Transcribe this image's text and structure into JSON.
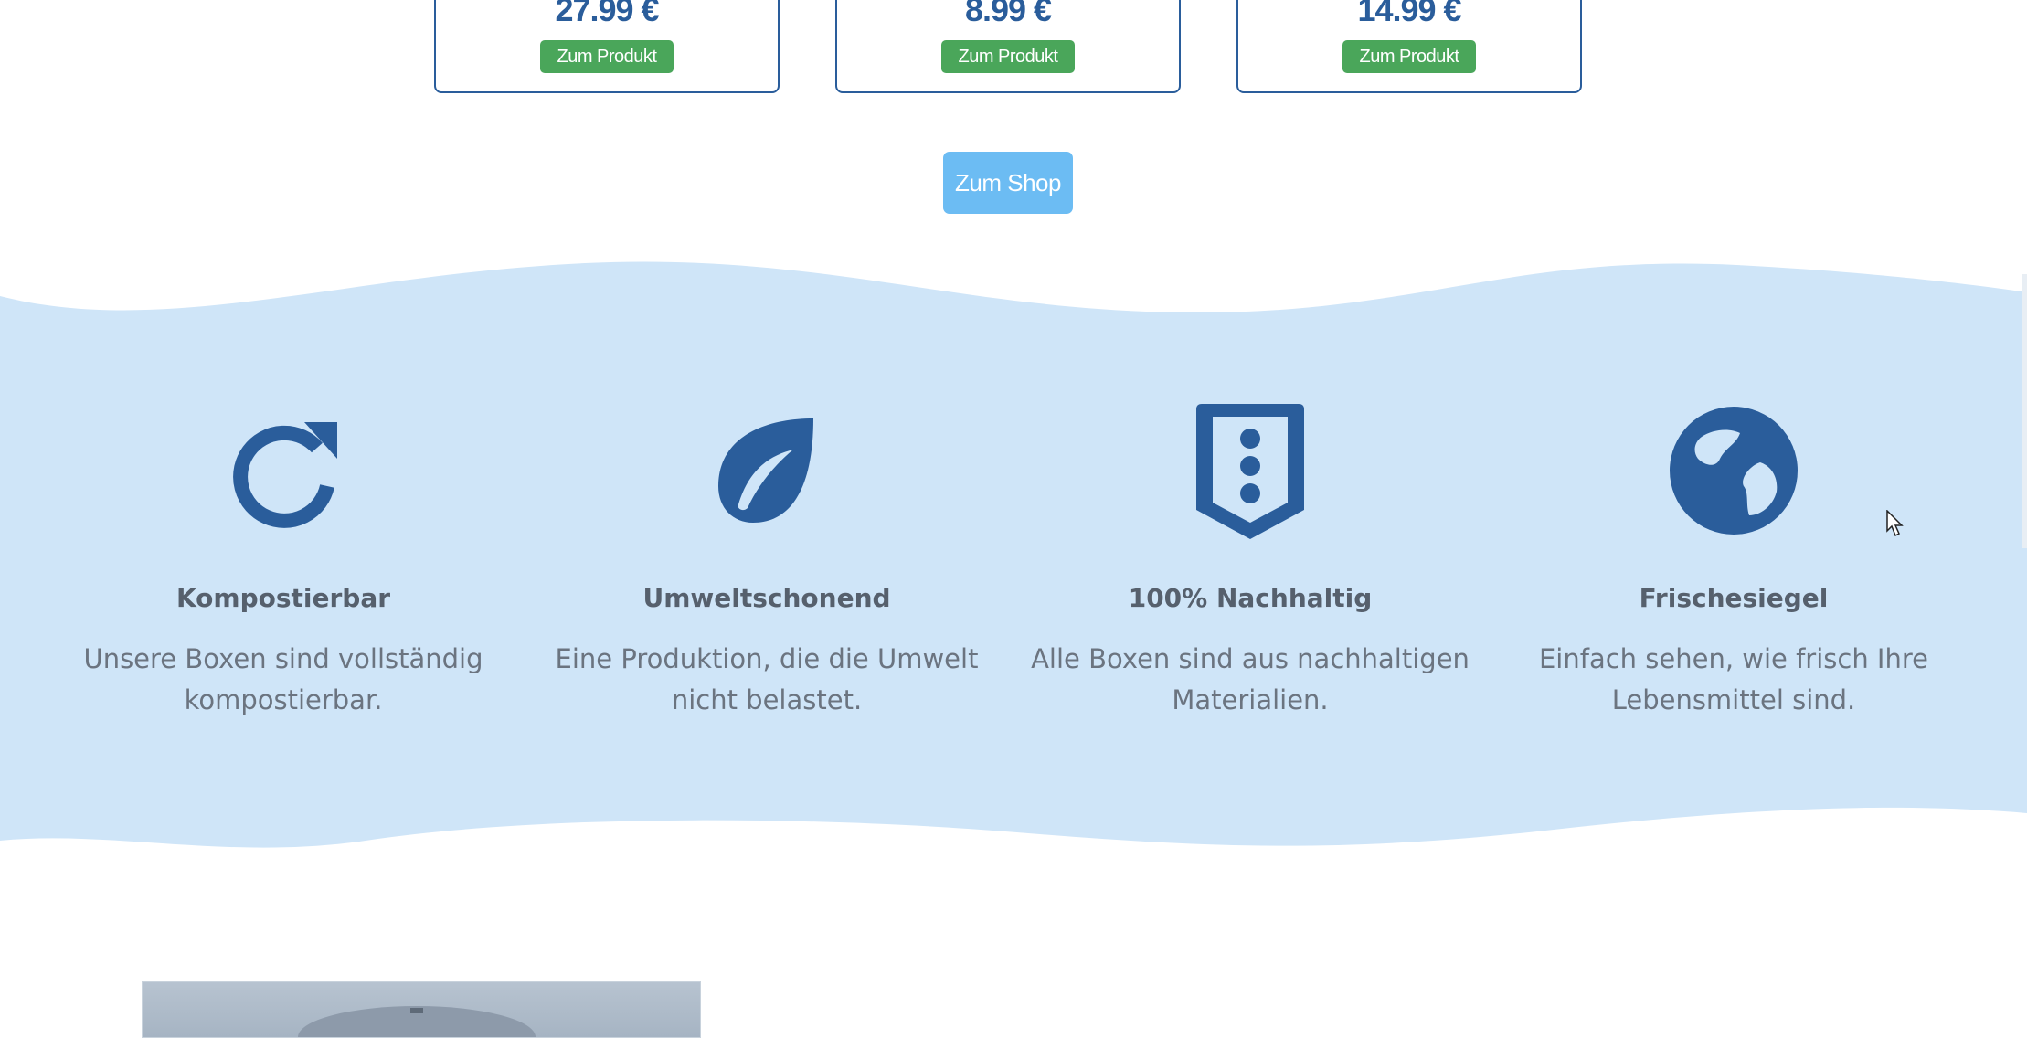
{
  "products": [
    {
      "price": "27.99 €",
      "button_label": "Zum Produkt"
    },
    {
      "price": "8.99 €",
      "button_label": "Zum Produkt"
    },
    {
      "price": "14.99 €",
      "button_label": "Zum Produkt"
    }
  ],
  "shop_button_label": "Zum Shop",
  "features": [
    {
      "icon": "refresh-arrow-icon",
      "title": "Kompostierbar",
      "description": "Unsere Boxen sind vollständig kompostierbar."
    },
    {
      "icon": "leaf-icon",
      "title": "Umweltschonend",
      "description": "Eine Produktion, die die Umwelt nicht belastet."
    },
    {
      "icon": "badge-dots-icon",
      "title": "100% Nachhaltig",
      "description": "Alle Boxen sind aus nachhaltigen Materialien."
    },
    {
      "icon": "globe-icon",
      "title": "Frischesiegel",
      "description": "Einfach sehen, wie frisch Ihre Lebensmittel sind."
    }
  ],
  "colors": {
    "primary_blue": "#2a5d9b",
    "button_green": "#4aa65a",
    "shop_button_blue": "#6cbcf3",
    "band_background": "#cfe5f8",
    "text_gray": "#6b7480"
  }
}
